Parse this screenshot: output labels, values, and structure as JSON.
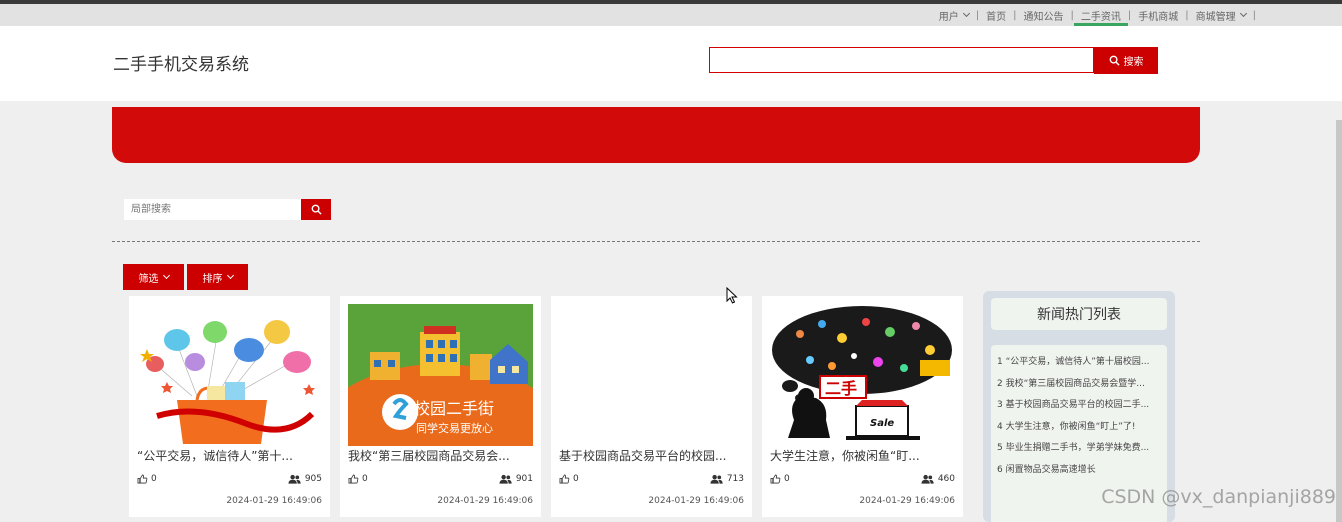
{
  "nav": {
    "items": [
      {
        "label": "用户",
        "dropdown": true
      },
      {
        "label": "首页"
      },
      {
        "label": "通知公告"
      },
      {
        "label": "二手资讯",
        "active": true
      },
      {
        "label": "手机商城"
      },
      {
        "label": "商城管理",
        "dropdown": true
      }
    ]
  },
  "header": {
    "title": "二手手机交易系统",
    "search_placeholder": "",
    "search_button": "搜索"
  },
  "local_search": {
    "placeholder": "局部搜索"
  },
  "filters": {
    "filter_label": "筛选",
    "sort_label": "排序"
  },
  "cards": [
    {
      "title": "“公平交易，诚信待人”第十...",
      "likes": "0",
      "views": "905",
      "date": "2024-01-29 16:49:06",
      "image": "balloons-gift-bag"
    },
    {
      "title": "我校“第三届校园商品交易会...",
      "likes": "0",
      "views": "901",
      "date": "2024-01-29 16:49:06",
      "image": "campus-market-poster"
    },
    {
      "title": "基于校园商品交易平台的校园...",
      "likes": "0",
      "views": "713",
      "date": "2024-01-29 16:49:06",
      "image": "blank"
    },
    {
      "title": "大学生注意，你被闲鱼“盯...",
      "likes": "0",
      "views": "460",
      "date": "2024-01-29 16:49:06",
      "image": "second-hand-laptop"
    }
  ],
  "sidebar": {
    "title": "新闻热门列表",
    "items": [
      "1 “公平交易，诚信待人”第十届校园...",
      "2 我校“第三届校园商品交易会暨学...",
      "3 基于校园商品交易平台的校园二手...",
      "4 大学生注意，你被闲鱼“盯上”了!",
      "5 毕业生捐赠二手书，学弟学妹免费...",
      "6 闲置物品交易高速增长"
    ]
  },
  "poster": {
    "main_text": "校园二手街",
    "sub_text": "同学交易更放心"
  },
  "laptop_art": {
    "badge_text": "二手",
    "sale_text": "Sale"
  },
  "watermark": "CSDN @vx_danpianji889",
  "colors": {
    "accent_red": "#cc0000",
    "banner_red": "#d20a0a",
    "active_green": "#3aa55f"
  }
}
